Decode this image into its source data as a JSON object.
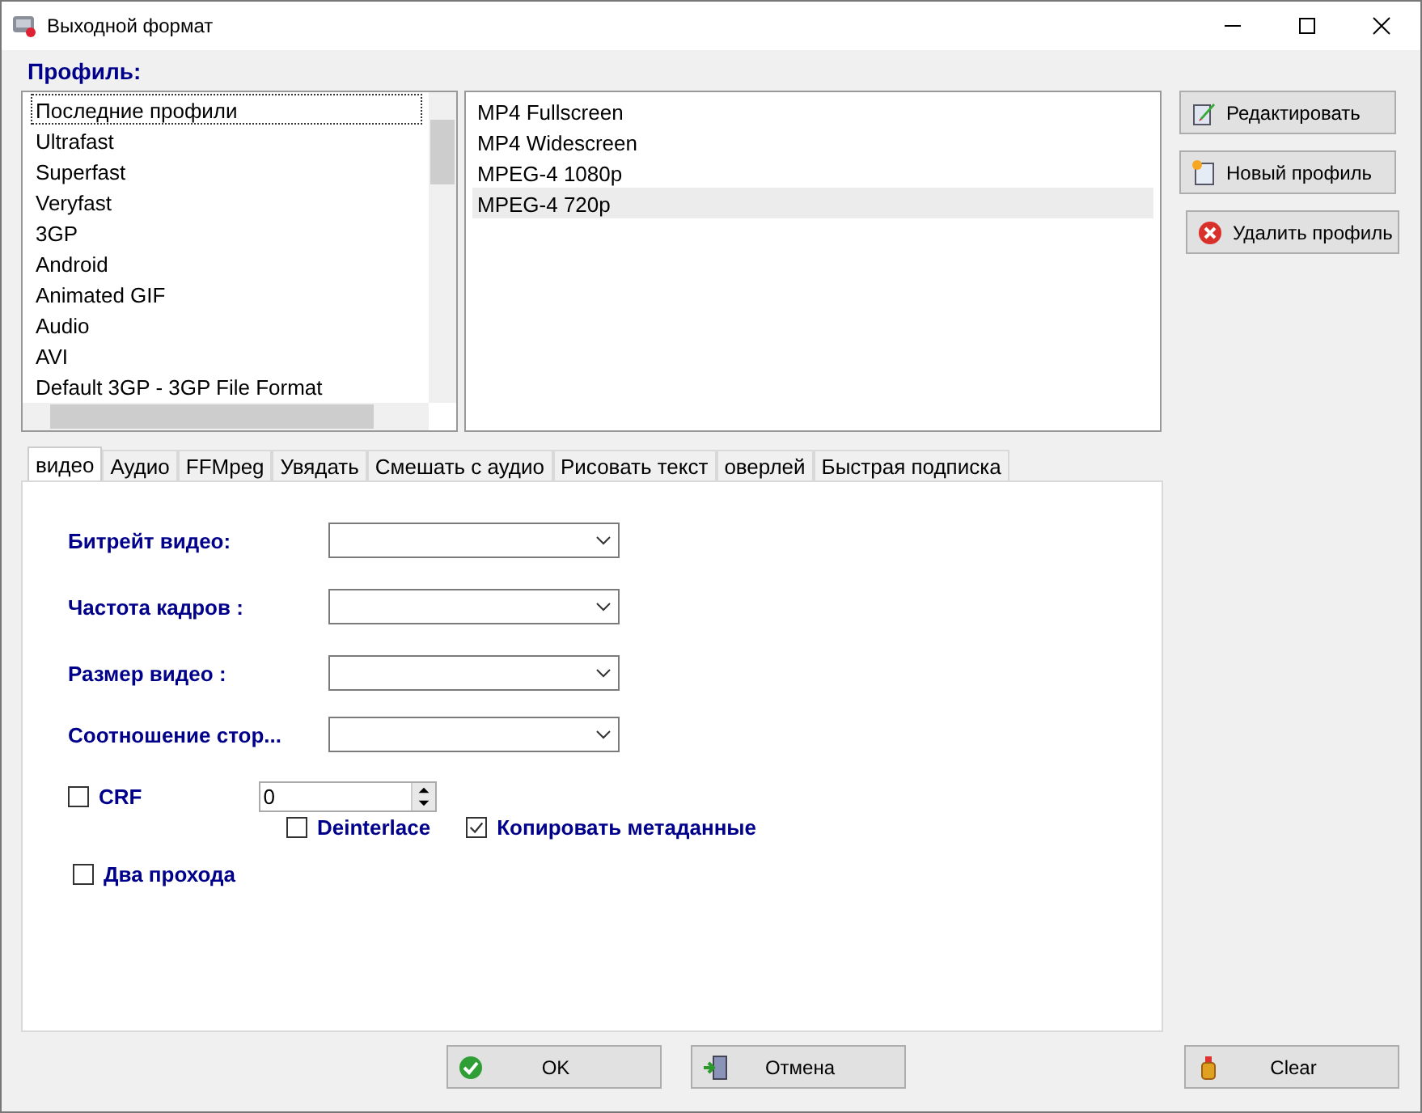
{
  "window": {
    "title": "Выходной формат"
  },
  "profile_label": "Профиль:",
  "categories": [
    {
      "label": "Последние профили",
      "focused": true
    },
    {
      "label": "Ultrafast",
      "focused": false
    },
    {
      "label": "Superfast",
      "focused": false
    },
    {
      "label": "Veryfast",
      "focused": false
    },
    {
      "label": "3GP",
      "focused": false
    },
    {
      "label": "Android",
      "focused": false
    },
    {
      "label": "Animated GIF",
      "focused": false
    },
    {
      "label": "Audio",
      "focused": false
    },
    {
      "label": "AVI",
      "focused": false
    },
    {
      "label": "Default 3GP - 3GP File Format",
      "focused": false
    }
  ],
  "presets": [
    {
      "label": "MP4 Fullscreen",
      "selected": false
    },
    {
      "label": "MP4 Widescreen",
      "selected": false
    },
    {
      "label": "MPEG-4 1080p",
      "selected": false
    },
    {
      "label": "MPEG-4 720p",
      "selected": true
    }
  ],
  "side_buttons": [
    {
      "label": "Редактировать",
      "kind": "edit"
    },
    {
      "label": "Новый профиль",
      "kind": "new"
    },
    {
      "label": "Удалить профиль",
      "kind": "delete"
    }
  ],
  "tabs": [
    {
      "label": "видео",
      "selected": true
    },
    {
      "label": "Аудио",
      "selected": false
    },
    {
      "label": "FFMpeg",
      "selected": false
    },
    {
      "label": "Увядать",
      "selected": false
    },
    {
      "label": "Смешать с аудио",
      "selected": false
    },
    {
      "label": "Рисовать текст",
      "selected": false
    },
    {
      "label": "оверлей",
      "selected": false
    },
    {
      "label": "Быстрая подписка",
      "selected": false
    }
  ],
  "fields": [
    {
      "label": "Битрейт видео:"
    },
    {
      "label": "Частота кадров :"
    },
    {
      "label": "Размер видео :"
    },
    {
      "label": "Соотношение стор..."
    }
  ],
  "options": [
    {
      "label": "CRF",
      "checked": false
    },
    {
      "label": "Deinterlace",
      "checked": false
    },
    {
      "label": "Копировать метаданные",
      "checked": true
    },
    {
      "label": "Два прохода",
      "checked": false
    }
  ],
  "crf_value": "0",
  "bottom_buttons": [
    {
      "label": "OK",
      "kind": "ok"
    },
    {
      "label": "Отмена",
      "kind": "cancel"
    },
    {
      "label": "Clear",
      "kind": "clear"
    }
  ]
}
